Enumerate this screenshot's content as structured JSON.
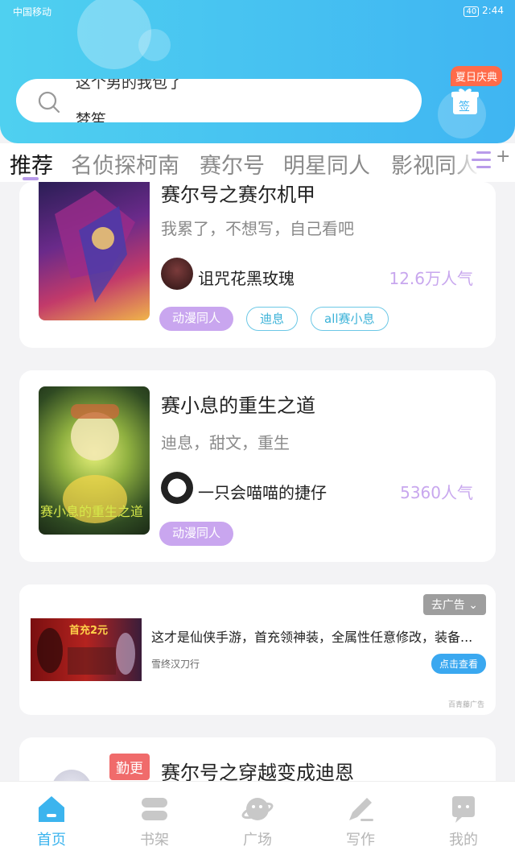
{
  "status_bar": {
    "carrier": "中国移动",
    "time": "2:44",
    "battery": "40"
  },
  "search": {
    "line1": "这个男的我包了",
    "line2": "梦笙"
  },
  "signin": {
    "badge": "夏日庆典",
    "label": "签"
  },
  "tabs": [
    {
      "label": "推荐",
      "active": true
    },
    {
      "label": "名侦探柯南"
    },
    {
      "label": "赛尔号"
    },
    {
      "label": "明星同人"
    },
    {
      "label": "影视同人"
    }
  ],
  "books": [
    {
      "title": "赛尔号之赛尔机甲",
      "desc": "我累了，不想写，自己看吧",
      "author": "诅咒花黑玫瑰",
      "popularity": "12.6万人气",
      "tags": [
        "动漫同人",
        "迪息",
        "all赛小息"
      ]
    },
    {
      "title": "赛小息的重生之道",
      "desc": "迪息，甜文，重生",
      "author": "一只会喵喵的捷仔",
      "popularity": "5360人气",
      "tags": [
        "动漫同人"
      ],
      "cover_text": "赛小息的重生之道"
    }
  ],
  "ad": {
    "close_label": "去广告",
    "title": "这才是仙侠手游，首充领神装，全属性任意修改，装备...",
    "source": "雪终汉刀行",
    "cta": "点击查看",
    "mark": "百青藤广告",
    "img_text": "首充2元"
  },
  "book3": {
    "badge": "勤更",
    "title": "赛尔号之穿越变成迪恩"
  },
  "bottom_nav": [
    {
      "label": "首页",
      "icon": "home-icon",
      "active": true
    },
    {
      "label": "书架",
      "icon": "bookshelf-icon"
    },
    {
      "label": "广场",
      "icon": "planet-icon"
    },
    {
      "label": "写作",
      "icon": "write-icon"
    },
    {
      "label": "我的",
      "icon": "profile-icon"
    }
  ],
  "colors": {
    "header": "#3fb5f2",
    "accent": "#3cb4ee",
    "tag_purple": "#c9a6ef",
    "popularity": "#c8a7ee"
  }
}
